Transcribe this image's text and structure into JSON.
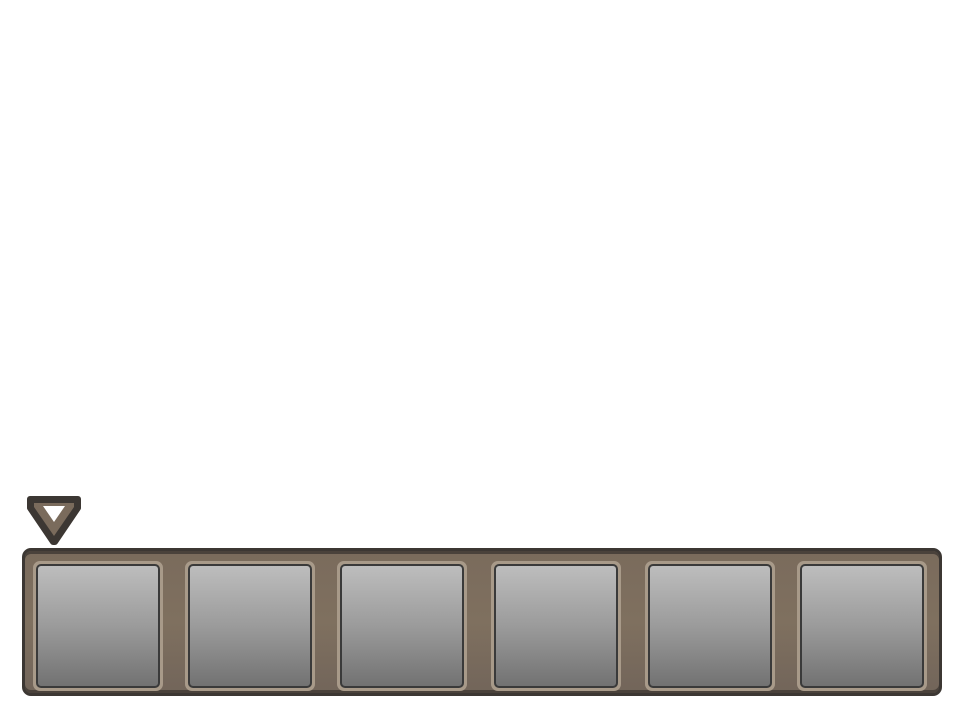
{
  "hotbar": {
    "slot_count": 6,
    "selected_slot": 1,
    "slots": [
      {
        "id": "slot-1",
        "item": null
      },
      {
        "id": "slot-2",
        "item": null
      },
      {
        "id": "slot-3",
        "item": null
      },
      {
        "id": "slot-4",
        "item": null
      },
      {
        "id": "slot-5",
        "item": null
      },
      {
        "id": "slot-6",
        "item": null
      }
    ]
  },
  "selector": {
    "icon": "chevron-down-icon"
  },
  "colors": {
    "background": "#ffffff",
    "bar_fill": "#7a6b5c",
    "bar_border": "#3c3733",
    "slot_border": "#a89a89",
    "slot_top": "#bdbdbd",
    "slot_bottom": "#727272",
    "selector_fill": "#7a6b5c",
    "selector_outline": "#3c3733"
  }
}
